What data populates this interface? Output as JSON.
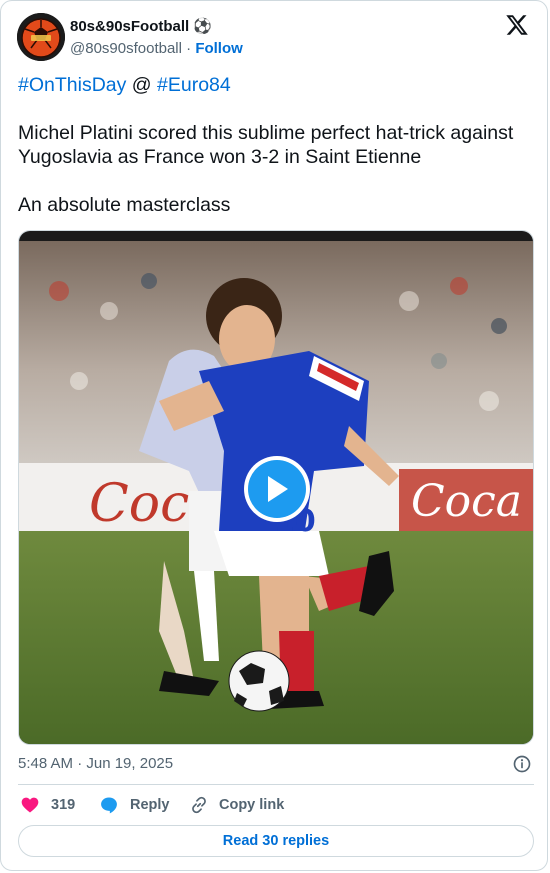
{
  "author": {
    "display_name": "80s&90sFootball",
    "name_emoji": "⚽",
    "handle": "@80s90sfootball",
    "separator": "·",
    "follow_label": "Follow"
  },
  "tweet": {
    "hashtag_1": "#OnThisDay",
    "at_symbol": "@",
    "hashtag_2": "#Euro84",
    "paragraph_1": "Michel Platini scored this sublime perfect hat-trick against Yugoslavia as France won 3-2 in Saint Etienne",
    "paragraph_2": "An absolute masterclass"
  },
  "media": {
    "type": "video",
    "icon": "play-icon"
  },
  "meta": {
    "timestamp": "5:48 AM · Jun 19, 2025"
  },
  "actions": {
    "like_count": "319",
    "reply_label": "Reply",
    "copy_label": "Copy link"
  },
  "read_replies_label": "Read 30 replies",
  "colors": {
    "link": "#006fd6",
    "like": "#f91880",
    "reply": "#1d9bf0",
    "secondary_text": "#536471",
    "border": "#cfd9de"
  }
}
